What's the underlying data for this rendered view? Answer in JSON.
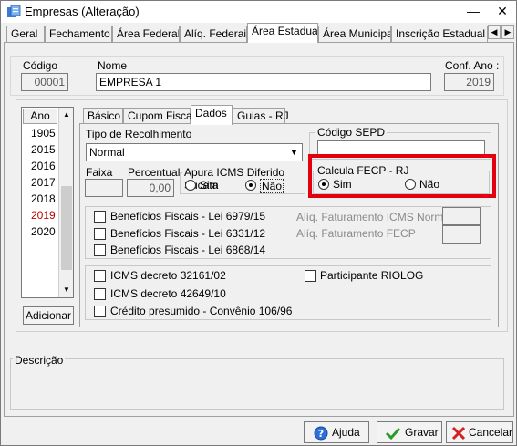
{
  "window": {
    "title": "Empresas (Alteração)",
    "minimize": "—",
    "close": "✕"
  },
  "tabs": [
    "Geral",
    "Fechamento",
    "Área Federal",
    "Alíq. Federais",
    "Área Estadual",
    "Área Municipal",
    "Inscrição Estadual S"
  ],
  "tab_scroll": {
    "left": "◀",
    "right": "▶"
  },
  "header": {
    "codigo_label": "Código",
    "codigo_value": "00001",
    "nome_label": "Nome",
    "nome_value": "EMPRESA 1",
    "conf_ano_label": "Conf. Ano :",
    "conf_ano_value": "2019"
  },
  "years": {
    "header": "Ano",
    "items": [
      "1905",
      "2015",
      "2016",
      "2017",
      "2018",
      "2019",
      "2020"
    ],
    "selected": "2019",
    "selected_color": "#c00000",
    "add_button": "Adicionar"
  },
  "subtabs": [
    "Básico",
    "Cupom Fiscal",
    "Dados",
    "Guias - RJ"
  ],
  "dados": {
    "tipo_recolhimento_label": "Tipo de Recolhimento",
    "tipo_recolhimento_value": "Normal",
    "codigo_sepd_label": "Código SEPD",
    "codigo_sepd_value": "",
    "faixa_label": "Faixa",
    "faixa_value": "",
    "percentual_label": "Percentual",
    "percentual_value": "0,00",
    "apura_label": "Apura ICMS Diferido Sucata",
    "apura_sim": "Sim",
    "apura_nao": "Não",
    "fecp_label": "Calcula FECP - RJ",
    "fecp_sim": "Sim",
    "fecp_nao": "Não",
    "beneficios": [
      "Benefícios Fiscais - Lei 6979/15",
      "Benefícios Fiscais - Lei 6331/12",
      "Benefícios Fiscais - Lei 6868/14"
    ],
    "aliq_icms_label": "Alíq. Faturamento ICMS Normal",
    "aliq_fecp_label": "Alíq. Faturamento FECP",
    "decretos": [
      "ICMS decreto 32161/02",
      "ICMS decreto 42649/10",
      "Crédito presumido - Convênio 106/96"
    ],
    "participante": "Participante RIOLOG"
  },
  "descricao_label": "Descrição",
  "buttons": {
    "ajuda": "Ajuda",
    "gravar": "Gravar",
    "cancelar": "Cancelar"
  },
  "colors": {
    "highlight_box": "#e3000f",
    "selected_year": "#c00000"
  }
}
